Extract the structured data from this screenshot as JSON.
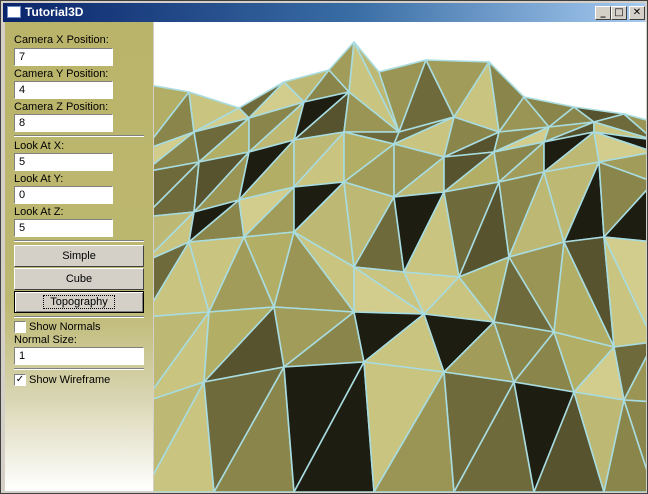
{
  "window": {
    "title": "Tutorial3D",
    "min_label": "_",
    "max_label": "□",
    "close_label": "✕"
  },
  "controls": {
    "camera_x_label": "Camera X Position:",
    "camera_x_value": "7",
    "camera_y_label": "Camera Y Position:",
    "camera_y_value": "4",
    "camera_z_label": "Camera Z Position:",
    "camera_z_value": "8",
    "look_x_label": "Look At X:",
    "look_x_value": "5",
    "look_y_label": "Look At Y:",
    "look_y_value": "0",
    "look_z_label": "Look At Z:",
    "look_z_value": "5",
    "simple_label": "Simple",
    "cube_label": "Cube",
    "topography_label": "Topography",
    "show_normals_label": "Show Normals",
    "show_normals_checked": false,
    "normal_size_label": "Normal Size:",
    "normal_size_value": "1",
    "show_wireframe_label": "Show Wireframe",
    "show_wireframe_checked": true,
    "check_mark": "✓"
  },
  "scene": {
    "surface_color": "#bdb873",
    "wire_color": "#a8dce0",
    "shadow_color": "#1e1d12"
  }
}
